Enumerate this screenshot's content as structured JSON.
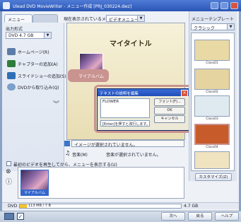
{
  "window": {
    "title": "Ulead DVD MovieWriter - メニュー作成 [PRJ_030224.dwz]"
  },
  "tabs": {
    "menu": "メニュー",
    "other": "",
    "current_menu_label": "現在表示されているメニュー:",
    "current_menu_value": "ビデオメニュー"
  },
  "left": {
    "output_format_label": "出力形式",
    "output_format_value": "DVD 4.7 GB",
    "items": [
      {
        "label": "ホームページ(R)"
      },
      {
        "label": "チャプターの追加(A)"
      },
      {
        "label": "スライドショーの追加(S)"
      },
      {
        "label": "DVDから取り込み(Q)"
      }
    ]
  },
  "preview": {
    "title": "マイタイトル",
    "album_button": "マイアルバム"
  },
  "dialog": {
    "title": "テキストの説明を編集",
    "text_value": "FLOWER",
    "font_button": "フォント(F)...",
    "ok_button": "OK",
    "cancel_button": "キャンセル",
    "hint": "[Enter]を押すと改行します。"
  },
  "below_preview": {
    "video_line": "イメージが選択されていません。",
    "sound_label": "音楽(M)",
    "sound_line": "音楽が選択されていません。",
    "checkbox_label": "最初のビデオを再生してから、メニューを表示する(U)"
  },
  "thumb_strip": {
    "caption": "マイアルバム"
  },
  "right": {
    "header": "メニューテンプレート",
    "category": "クラシック",
    "templates": [
      {
        "name": "Class01",
        "color": "#e9d9a5"
      },
      {
        "name": "Class02",
        "color": "#e5d3a0"
      },
      {
        "name": "Class03",
        "color": "#dfe9f0"
      },
      {
        "name": "Class04",
        "color": "#c85b2a"
      },
      {
        "name": "Class05",
        "color": "#efe3c0"
      }
    ],
    "customize_button": "カスタマイズ(Z)"
  },
  "statusbar": {
    "label": "DVD",
    "used": "113 MB / 7 B",
    "capacity": "4.7 GB"
  },
  "bottom": {
    "next": "次へ",
    "back": "戻る",
    "help": "ヘルプ"
  }
}
